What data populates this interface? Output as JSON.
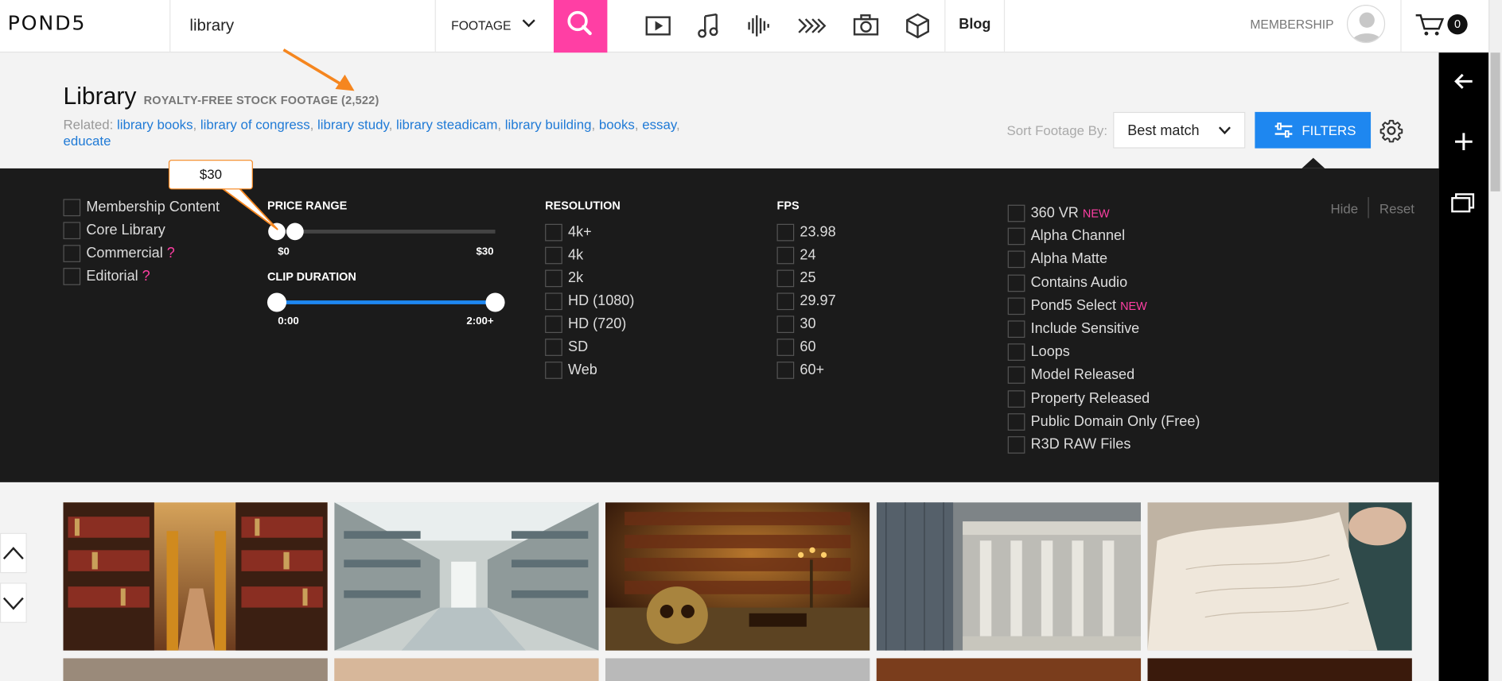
{
  "header": {
    "logo": "POND5",
    "search_value": "library",
    "search_type": "FOOTAGE",
    "blog": "Blog",
    "membership": "MEMBERSHIP",
    "cart_count": "0",
    "nav_icons": [
      "video-icon",
      "music-icon",
      "sound-fx-icon",
      "after-effects-icon",
      "photo-icon",
      "3d-model-icon"
    ]
  },
  "results": {
    "title": "Library",
    "label": "ROYALTY-FREE STOCK FOOTAGE (2,522)",
    "related_prefix": "Related:",
    "related": [
      "library books",
      "library of congress",
      "library study",
      "library steadicam",
      "library building",
      "books",
      "essay",
      "educate"
    ]
  },
  "sort": {
    "label": "Sort Footage By:",
    "value": "Best match"
  },
  "filters_button": "FILTERS",
  "filters": {
    "content_types": [
      {
        "label": "Membership Content",
        "help": ""
      },
      {
        "label": "Core Library",
        "help": ""
      },
      {
        "label": "Commercial",
        "help": "?"
      },
      {
        "label": "Editorial",
        "help": "?"
      }
    ],
    "price_range": {
      "title": "PRICE RANGE",
      "min_label": "$0",
      "max_label": "$30",
      "tooltip": "$30",
      "range_max": 30,
      "handle_low": 0,
      "handle_high": 2
    },
    "clip_duration": {
      "title": "CLIP DURATION",
      "min_label": "0:00",
      "max_label": "2:00+",
      "handle_low": 0,
      "handle_high": 1
    },
    "resolution": {
      "title": "RESOLUTION",
      "options": [
        "4k+",
        "4k",
        "2k",
        "HD (1080)",
        "HD (720)",
        "SD",
        "Web"
      ]
    },
    "fps": {
      "title": "FPS",
      "options": [
        "23.98",
        "24",
        "25",
        "29.97",
        "30",
        "60",
        "60+"
      ]
    },
    "misc": [
      {
        "label": "360 VR",
        "badge": "NEW"
      },
      {
        "label": "Alpha Channel",
        "badge": ""
      },
      {
        "label": "Alpha Matte",
        "badge": ""
      },
      {
        "label": "Contains Audio",
        "badge": ""
      },
      {
        "label": "Pond5 Select",
        "badge": "NEW"
      },
      {
        "label": "Include Sensitive",
        "badge": ""
      },
      {
        "label": "Loops",
        "badge": ""
      },
      {
        "label": "Model Released",
        "badge": ""
      },
      {
        "label": "Property Released",
        "badge": ""
      },
      {
        "label": "Public Domain Only (Free)",
        "badge": ""
      },
      {
        "label": "R3D RAW Files",
        "badge": ""
      }
    ],
    "hide": "Hide",
    "reset": "Reset"
  },
  "colors": {
    "accent": "#1e87f0",
    "search_button": "#ff3fa4",
    "panel": "#1b1b1b",
    "annotation": "#f5861f"
  }
}
